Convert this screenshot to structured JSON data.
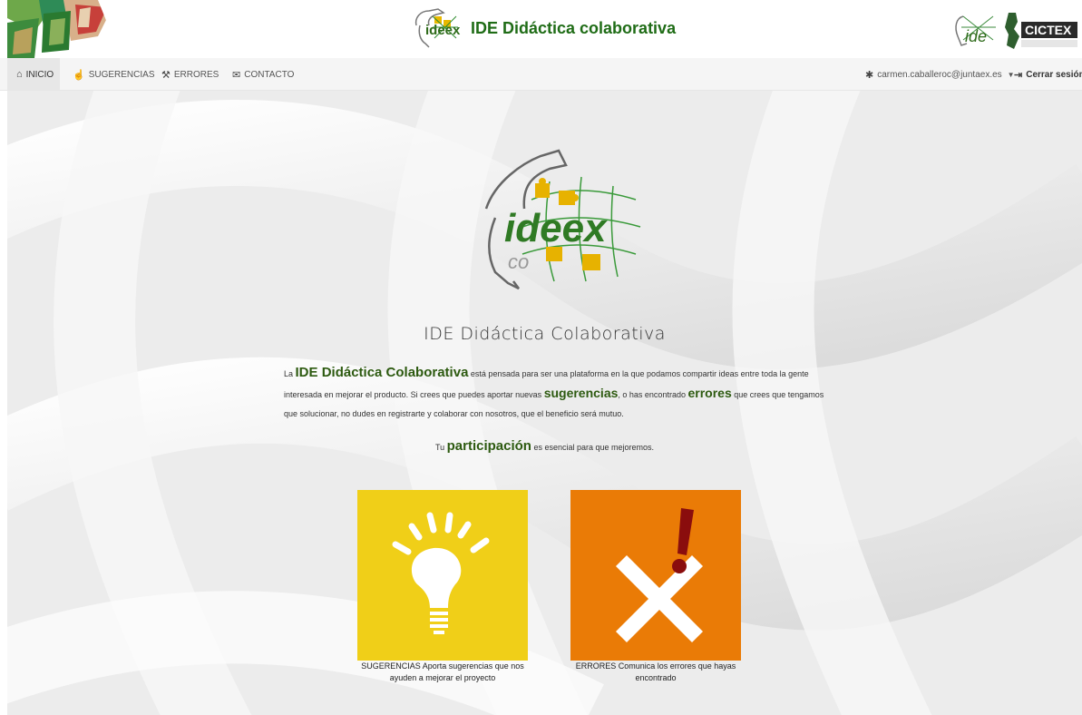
{
  "header": {
    "title": "IDE Didáctica colaborativa",
    "brand_logo_text": "ideex",
    "partner_logo_text": "CICTEX",
    "ide_logo_text": "ide"
  },
  "nav": {
    "items": [
      {
        "label": "INICIO",
        "icon": "home-icon"
      },
      {
        "label": "SUGERENCIAS",
        "icon": "hand-pointer-icon"
      },
      {
        "label": "ERRORES",
        "icon": "wrench-icon"
      },
      {
        "label": "CONTACTO",
        "icon": "envelope-icon"
      }
    ],
    "user": "carmen.caballeroc@juntaex.es",
    "logout": "Cerrar sesión"
  },
  "hero": {
    "logo_text": "ideex",
    "logo_subtext": "co",
    "title": "IDE Didáctica Colaborativa"
  },
  "intro": {
    "p1_a": "La ",
    "p1_b": "IDE Didáctica Colaborativa",
    "p1_c": " está pensada para ser una plataforma en la que podamos compartir ideas entre toda la gente interesada en mejorar el producto. Si crees que puedes aportar nuevas ",
    "p1_d": "sugerencias",
    "p1_e": ", o has encontrado ",
    "p1_f": "errores",
    "p1_g": " que crees que tengamos que solucionar, no dudes en registrarte y colaborar con nosotros, que el beneficio será mutuo.",
    "p2_a": "Tu ",
    "p2_b": "participación",
    "p2_c": " es esencial para que mejoremos."
  },
  "cards": [
    {
      "caption": "SUGERENCIAS Aporta sugerencias que nos ayuden a mejorar el proyecto",
      "icon": "lightbulb-icon",
      "color": "#f0cf18"
    },
    {
      "caption": "ERRORES Comunica los errores que hayas encontrado",
      "icon": "error-cross-icon",
      "color": "#ea7b06"
    }
  ],
  "colors": {
    "brand_green": "#1f6c16",
    "text_green": "#2d5a10"
  }
}
